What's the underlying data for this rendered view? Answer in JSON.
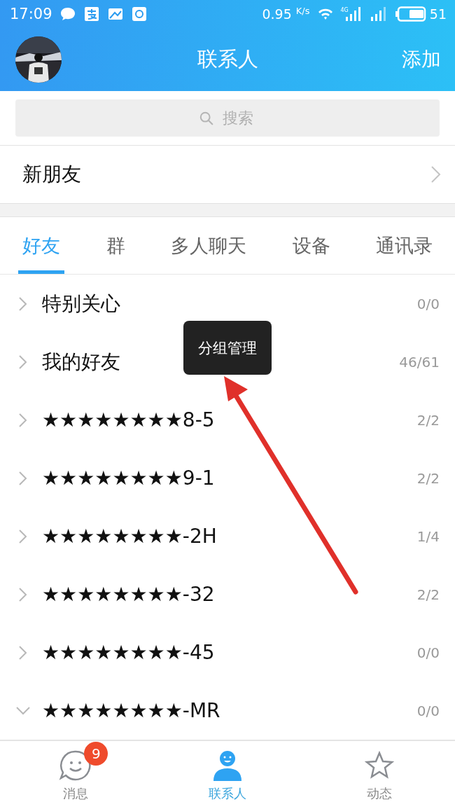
{
  "status_bar": {
    "time": "17:09",
    "speed": "0.95",
    "speed_unit": "K/s",
    "network": "4G",
    "battery": "51"
  },
  "header": {
    "title": "联系人",
    "action": "添加"
  },
  "search": {
    "placeholder": "搜索"
  },
  "new_friends": {
    "label": "新朋友"
  },
  "tabs": [
    {
      "label": "好友",
      "selected": true
    },
    {
      "label": "群",
      "selected": false
    },
    {
      "label": "多人聊天",
      "selected": false
    },
    {
      "label": "设备",
      "selected": false
    },
    {
      "label": "通讯录",
      "selected": false
    }
  ],
  "groups": [
    {
      "name": "特别关心",
      "count": "0/0",
      "expanded": false
    },
    {
      "name": "我的好友",
      "count": "46/61",
      "expanded": false
    },
    {
      "name": "★★★★★★★★8-5",
      "count": "2/2",
      "expanded": false
    },
    {
      "name": "★★★★★★★★9-1",
      "count": "2/2",
      "expanded": false
    },
    {
      "name": "★★★★★★★★-2H",
      "count": "1/4",
      "expanded": false
    },
    {
      "name": "★★★★★★★★-32",
      "count": "2/2",
      "expanded": false
    },
    {
      "name": "★★★★★★★★-45",
      "count": "0/0",
      "expanded": false
    },
    {
      "name": "★★★★★★★★-MR",
      "count": "0/0",
      "expanded": true
    }
  ],
  "tooltip": {
    "label": "分组管理"
  },
  "bottom_nav": [
    {
      "kind": "messages",
      "label": "消息",
      "badge": "9",
      "selected": false
    },
    {
      "kind": "contacts",
      "label": "联系人",
      "selected": true
    },
    {
      "kind": "feed",
      "label": "动态",
      "selected": false
    }
  ]
}
